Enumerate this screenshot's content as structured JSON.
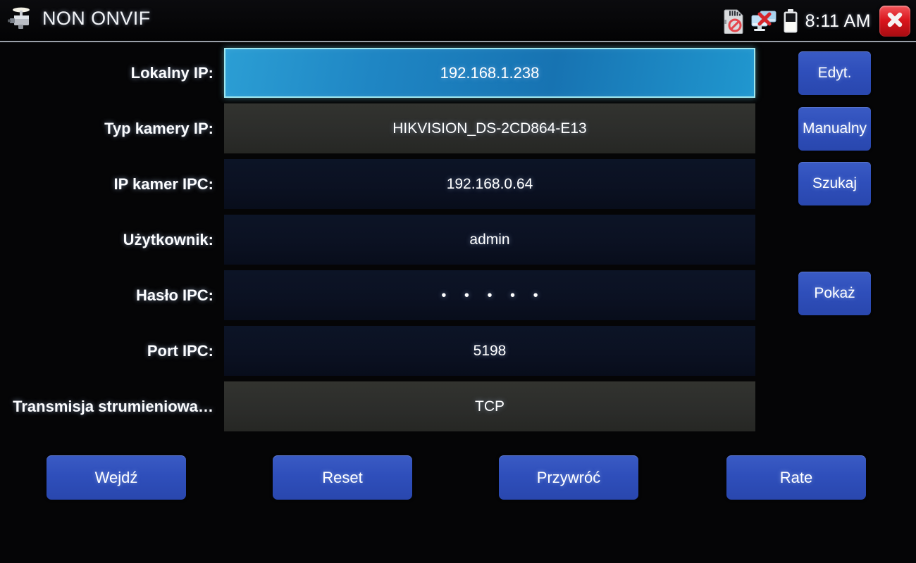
{
  "titlebar": {
    "app_title": "NON ONVIF",
    "camera_icon": "cctv-camera-icon",
    "clock": "8:11 AM",
    "status_icons": [
      {
        "name": "sd-card-disabled-icon",
        "label": "SD card not inserted"
      },
      {
        "name": "network-disconnected-icon",
        "label": "Network disconnected"
      },
      {
        "name": "battery-icon",
        "label": "Battery"
      }
    ],
    "close_label": "×"
  },
  "form": {
    "rows": [
      {
        "label": "Lokalny IP:",
        "value": "192.168.1.238",
        "style": "selected",
        "masked": false
      },
      {
        "label": "Typ kamery IP:",
        "value": "HIKVISION_DS-2CD864-E13",
        "style": "gray",
        "masked": false
      },
      {
        "label": "IP kamer IPC:",
        "value": "192.168.0.64",
        "style": "dark",
        "masked": false
      },
      {
        "label": "Użytkownik:",
        "value": "admin",
        "style": "dark",
        "masked": false
      },
      {
        "label": "Hasło IPC:",
        "value": "• • • • •",
        "style": "dark",
        "masked": true
      },
      {
        "label": "Port IPC:",
        "value": "5198",
        "style": "dark",
        "masked": false
      },
      {
        "label": "Transmisja strumieniowa…",
        "value": "TCP",
        "style": "gray",
        "masked": false
      }
    ]
  },
  "side_buttons": [
    {
      "label": "Edyt."
    },
    {
      "label": "Manualny"
    },
    {
      "label": "Szukaj"
    },
    {
      "label": "Pokaż"
    }
  ],
  "bottom_buttons": [
    {
      "label": "Wejdź"
    },
    {
      "label": "Reset"
    },
    {
      "label": "Przywróć"
    },
    {
      "label": "Rate"
    }
  ],
  "colors": {
    "background": "#050506",
    "selected_row": "#1f86c4",
    "selected_border": "#9fe7ef",
    "button_blue": "#2f4fbb",
    "gray_row": "#2c2d2b",
    "dark_row": "#0b1122",
    "close_red": "#d9151c",
    "text": "#ffffff"
  }
}
